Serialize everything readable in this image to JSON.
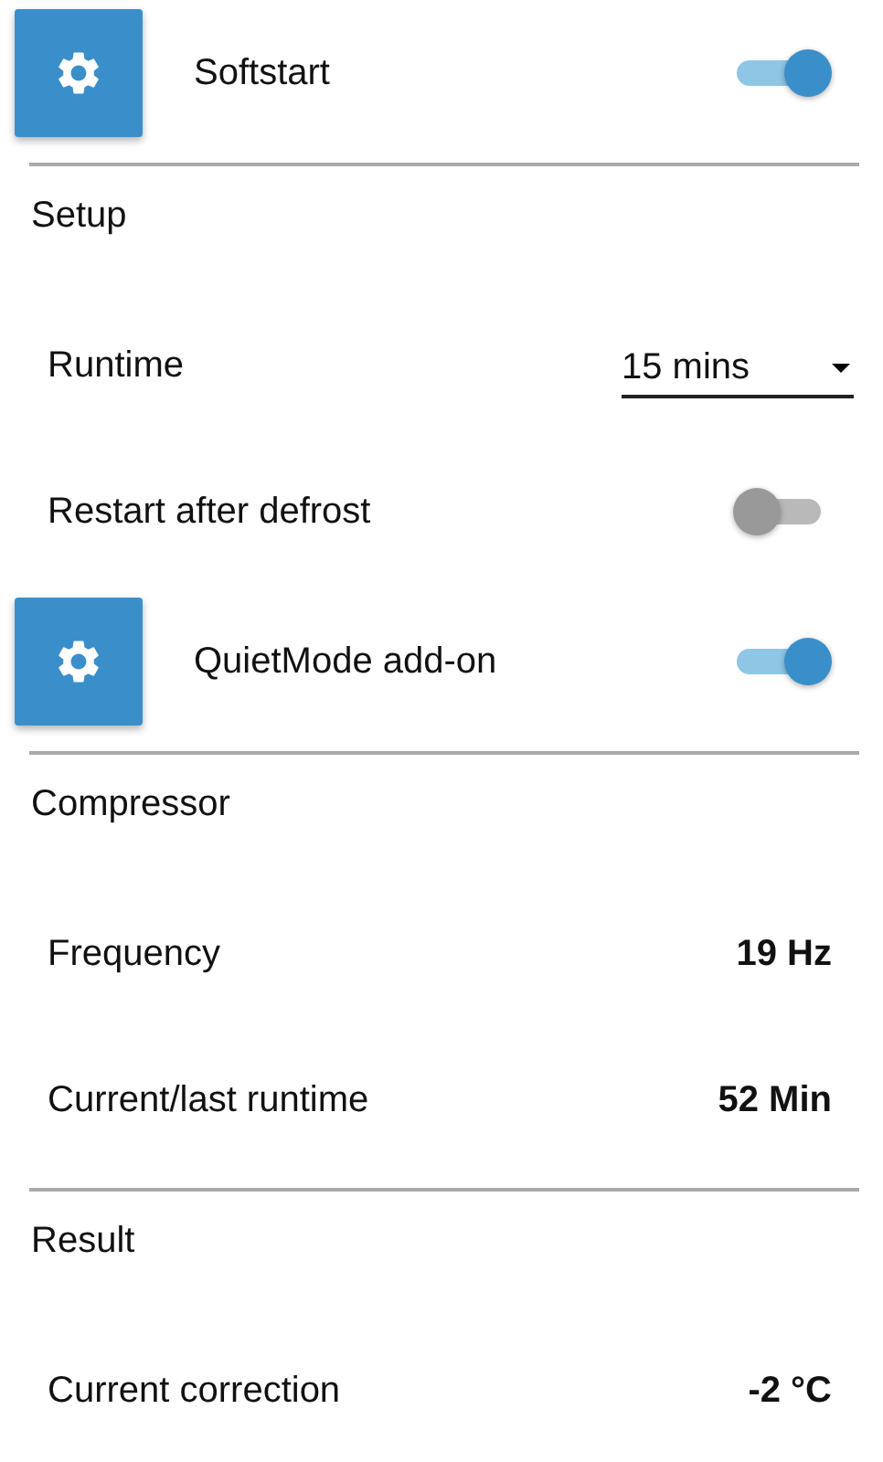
{
  "items": [
    {
      "kind": "feature",
      "label": "Softstart",
      "on": true
    },
    {
      "kind": "heading",
      "label": "Setup"
    },
    {
      "kind": "select",
      "label": "Runtime",
      "value": "15 mins"
    },
    {
      "kind": "toggle",
      "label": "Restart after defrost",
      "on": false
    },
    {
      "kind": "feature",
      "label": "QuietMode add-on",
      "on": true
    },
    {
      "kind": "heading",
      "label": "Compressor"
    },
    {
      "kind": "value",
      "label": "Frequency",
      "value": "19 Hz"
    },
    {
      "kind": "value",
      "label": "Current/last runtime",
      "value": "52 Min"
    },
    {
      "kind": "heading",
      "label": "Result"
    },
    {
      "kind": "value",
      "label": "Current correction",
      "value": "-2 °C"
    }
  ]
}
